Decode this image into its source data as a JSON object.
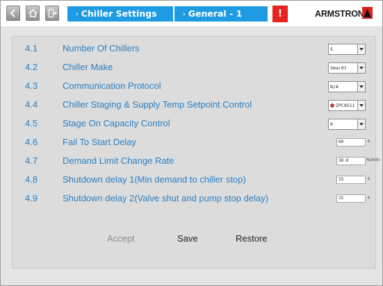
{
  "header": {
    "breadcrumb": [
      "Chiller Settings",
      "General - 1"
    ],
    "alarm_label": "!",
    "logo_text": "ARMSTRONG"
  },
  "rows": [
    {
      "num": "4.1",
      "label": "Number Of Chillers",
      "control": "select",
      "value": "5"
    },
    {
      "num": "4.2",
      "label": "Chiller Make",
      "control": "select",
      "value": "Smardt"
    },
    {
      "num": "4.3",
      "label": "Communication Protocol",
      "control": "select",
      "value": "N/A"
    },
    {
      "num": "4.4",
      "label": "Chiller Staging & Supply Temp Setpoint Control",
      "control": "select",
      "value": "IPC9511"
    },
    {
      "num": "4.5",
      "label": "Stage On Capacity Control",
      "control": "select",
      "value": "0"
    },
    {
      "num": "4.6",
      "label": "Fail To Start Delay",
      "control": "input",
      "value": "60",
      "unit": "s"
    },
    {
      "num": "4.7",
      "label": "Demand Limit Change Rate",
      "control": "input",
      "value": "30.0",
      "unit": "%/min"
    },
    {
      "num": "4.8",
      "label": "Shutdown delay 1(Min demand to chiller stop)",
      "control": "input",
      "value": "15",
      "unit": "s"
    },
    {
      "num": "4.9",
      "label": "Shutdown delay 2(Valve shut and pump stop delay)",
      "control": "input",
      "value": "15",
      "unit": "s"
    }
  ],
  "actions": {
    "accept": "Accept",
    "save": "Save",
    "restore": "Restore"
  },
  "colors": {
    "accent": "#1e9be3",
    "label": "#2c7fc2",
    "alarm": "#e8221f",
    "panel": "#dcdcdc"
  }
}
